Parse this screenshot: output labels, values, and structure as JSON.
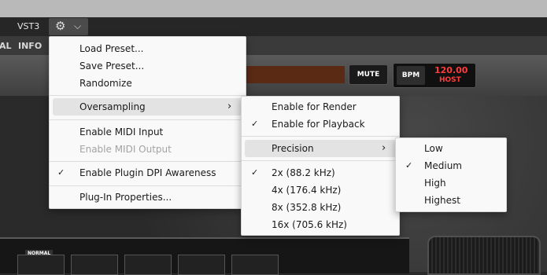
{
  "host": {
    "format_label": "VST3",
    "gear_icon": "⚙",
    "chevron_icon": "⌵"
  },
  "plugin_nav": {
    "tab_partial": "AL",
    "tab_info": "INFO"
  },
  "controls": {
    "mute_label": "MUTE",
    "bpm_label": "BPM",
    "bpm_value": "120.00",
    "bpm_source": "HOST",
    "amp_badge": "NORMAL"
  },
  "colors": {
    "menu_bg": "#f9f9f9",
    "highlight": "#e3e3e3",
    "disabled_text": "#a3a3a3",
    "bpm_text": "#ff3c3c"
  },
  "main_menu": {
    "load_preset": "Load Preset...",
    "save_preset": "Save Preset...",
    "randomize": "Randomize",
    "oversampling": "Oversampling",
    "enable_midi_input": "Enable MIDI Input",
    "enable_midi_output": "Enable MIDI Output",
    "enable_dpi": "Enable Plugin DPI Awareness",
    "plugin_properties": "Plug-In Properties..."
  },
  "oversampling_menu": {
    "enable_render": "Enable for Render",
    "enable_playback": "Enable for Playback",
    "precision": "Precision",
    "rate_2x": "2x (88.2 kHz)",
    "rate_4x": "4x (176.4 kHz)",
    "rate_8x": "8x (352.8 kHz)",
    "rate_16x": "16x (705.6 kHz)"
  },
  "precision_menu": {
    "low": "Low",
    "medium": "Medium",
    "high": "High",
    "highest": "Highest"
  },
  "glyphs": {
    "check": "✓",
    "submenu_arrow": "›"
  }
}
